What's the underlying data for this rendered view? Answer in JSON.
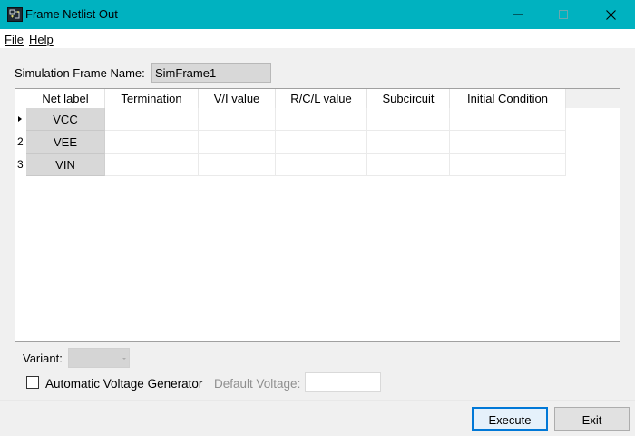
{
  "window": {
    "title": "Frame Netlist Out",
    "app_icon": "frame-netlist-app-icon",
    "controls": [
      "minimize-icon",
      "maximize-icon",
      "close-icon"
    ],
    "titlebar_color": "#00b2c0"
  },
  "menu": {
    "file": "File",
    "help": "Help"
  },
  "sim_frame": {
    "label": "Simulation Frame Name:",
    "value": "SimFrame1"
  },
  "grid": {
    "columns": [
      "Net label",
      "Termination",
      "V/I value",
      "R/C/L value",
      "Subcircuit",
      "Initial Condition"
    ],
    "rows": [
      {
        "header": "",
        "current": true,
        "cells": [
          "VCC",
          "",
          "",
          "",
          "",
          ""
        ]
      },
      {
        "header": "2",
        "current": false,
        "cells": [
          "VEE",
          "",
          "",
          "",
          "",
          ""
        ]
      },
      {
        "header": "3",
        "current": false,
        "cells": [
          "VIN",
          "",
          "",
          "",
          "",
          ""
        ]
      }
    ]
  },
  "variant": {
    "label": "Variant:",
    "value": ""
  },
  "auto_voltage": {
    "label": "Automatic Voltage Generator",
    "checked": false
  },
  "default_voltage": {
    "label": "Default Voltage:",
    "value": ""
  },
  "buttons": {
    "execute": "Execute",
    "exit": "Exit",
    "accent_color": "#0078d7"
  }
}
